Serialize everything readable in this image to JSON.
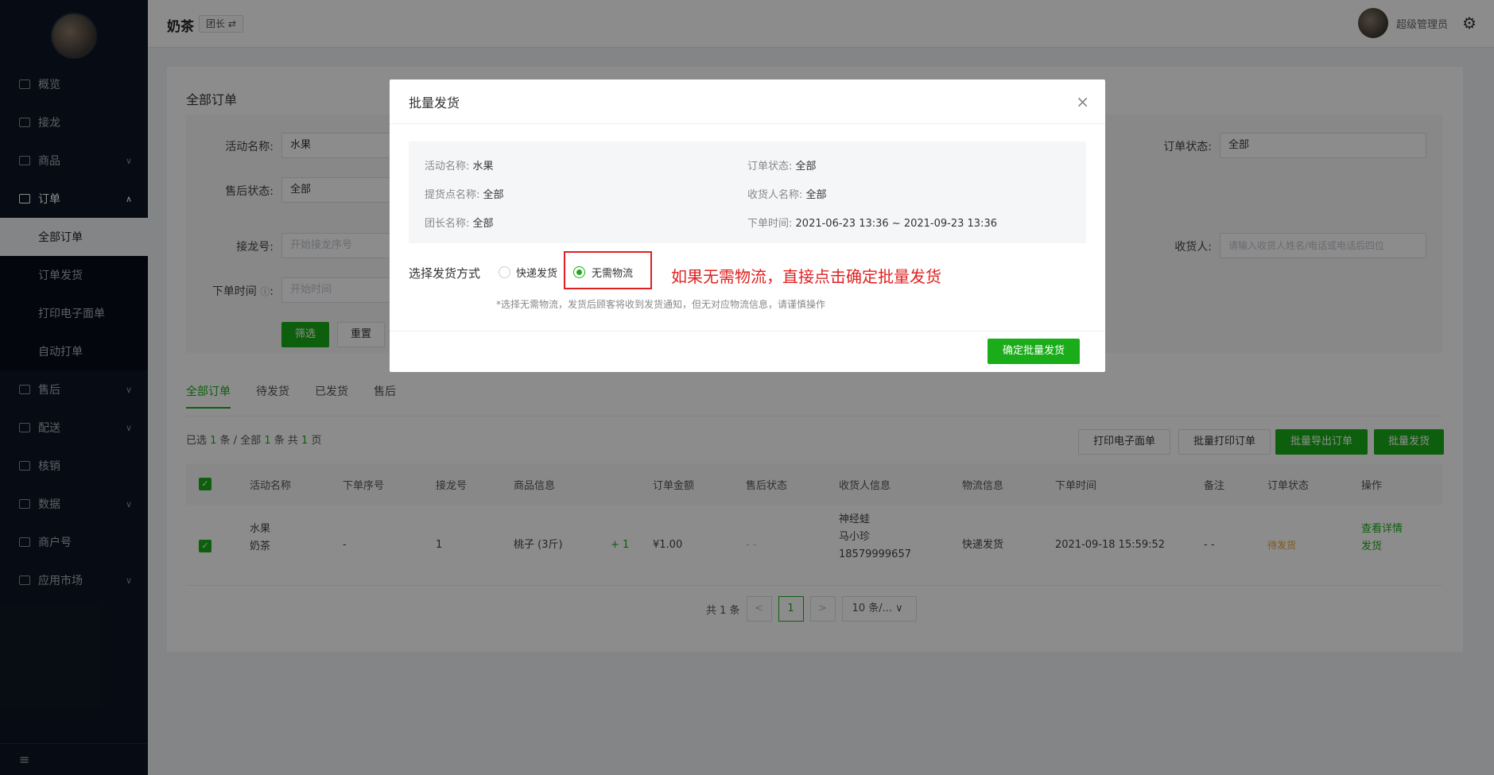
{
  "header": {
    "store_name": "奶茶",
    "role_tag": "团长 ⇄",
    "admin_name": "超级管理员"
  },
  "sidebar": {
    "items": [
      {
        "label": "概览"
      },
      {
        "label": "接龙"
      },
      {
        "label": "商品"
      },
      {
        "label": "订单"
      },
      {
        "label": "售后"
      },
      {
        "label": "配送"
      },
      {
        "label": "核销"
      },
      {
        "label": "数据"
      },
      {
        "label": "商户号"
      },
      {
        "label": "应用市场"
      }
    ],
    "order_sub": [
      {
        "label": "全部订单"
      },
      {
        "label": "订单发货"
      },
      {
        "label": "打印电子面单"
      },
      {
        "label": "自动打单"
      }
    ],
    "footer_icon": "≡"
  },
  "main": {
    "title": "全部订单",
    "filters": {
      "activity_label": "活动名称:",
      "activity_value": "水果",
      "aftersale_label": "售后状态:",
      "aftersale_value": "全部",
      "jielong_label": "接龙号:",
      "jielong_placeholder": "开始接龙序号",
      "order_time_label": "下单时间",
      "order_time_placeholder": "开始时间",
      "order_status_label": "订单状态:",
      "order_status_value": "全部",
      "receiver_label": "收货人:",
      "receiver_placeholder": "请输入收货人姓名/电话或电话后四位",
      "filter_btn": "筛选",
      "reset_btn": "重置"
    },
    "tabs": [
      "全部订单",
      "待发货",
      "已发货",
      "售后"
    ],
    "selection": {
      "pre": "已选 ",
      "selected": "1",
      "mid": " 条 / 全部 ",
      "total": "1",
      "mid2": " 条 共 ",
      "pages": "1",
      "post": " 页"
    },
    "actions": {
      "print_label": "打印电子面单",
      "batch_print": "批量打印订单",
      "batch_export": "批量导出订单",
      "batch_ship": "批量发货"
    },
    "table": {
      "headers": [
        "活动名称",
        "下单序号",
        "接龙号",
        "商品信息",
        "订单金额",
        "售后状态",
        "收货人信息",
        "物流信息",
        "下单时间",
        "备注",
        "订单状态",
        "操作"
      ],
      "row": {
        "activity": "水果",
        "store": "奶茶",
        "order_seq": "-",
        "jielong": "1",
        "product": "桃子 (3斤)",
        "qty": "+ 1",
        "amount": "¥1.00",
        "aftersale": "- -",
        "receiver_1": "神经蛙",
        "receiver_2": "马小珍",
        "receiver_3": "18579999657",
        "logistics": "快递发货",
        "order_time": "2021-09-18 15:59:52",
        "remark": "- -",
        "status": "待发货",
        "op_detail": "查看详情",
        "op_ship": "发货"
      }
    },
    "pager": {
      "total": "共 1 条",
      "prev": "<",
      "current": "1",
      "next": ">",
      "size": "10 条/... ∨"
    }
  },
  "modal": {
    "title": "批量发货",
    "close": "×",
    "info": {
      "activity_k": "活动名称:",
      "activity_v": "水果",
      "pickup_k": "提货点名称:",
      "pickup_v": "全部",
      "leader_k": "团长名称:",
      "leader_v": "全部",
      "status_k": "订单状态:",
      "status_v": "全部",
      "receiver_k": "收货人名称:",
      "receiver_v": "全部",
      "time_k": "下单时间:",
      "time_v": "2021-06-23 13:36 ~ 2021-09-23 13:36"
    },
    "method_label": "选择发货方式",
    "option_express": "快递发货",
    "option_none": "无需物流",
    "annotation": "如果无需物流，直接点击确定批量发货",
    "hint": "*选择无需物流，发货后顾客将收到发货通知，但无对应物流信息，请谨慎操作",
    "confirm": "确定批量发货"
  },
  "colors": {
    "accent": "#1aad19",
    "sidebar_bg": "#0e1725",
    "annotation": "#e02020"
  }
}
